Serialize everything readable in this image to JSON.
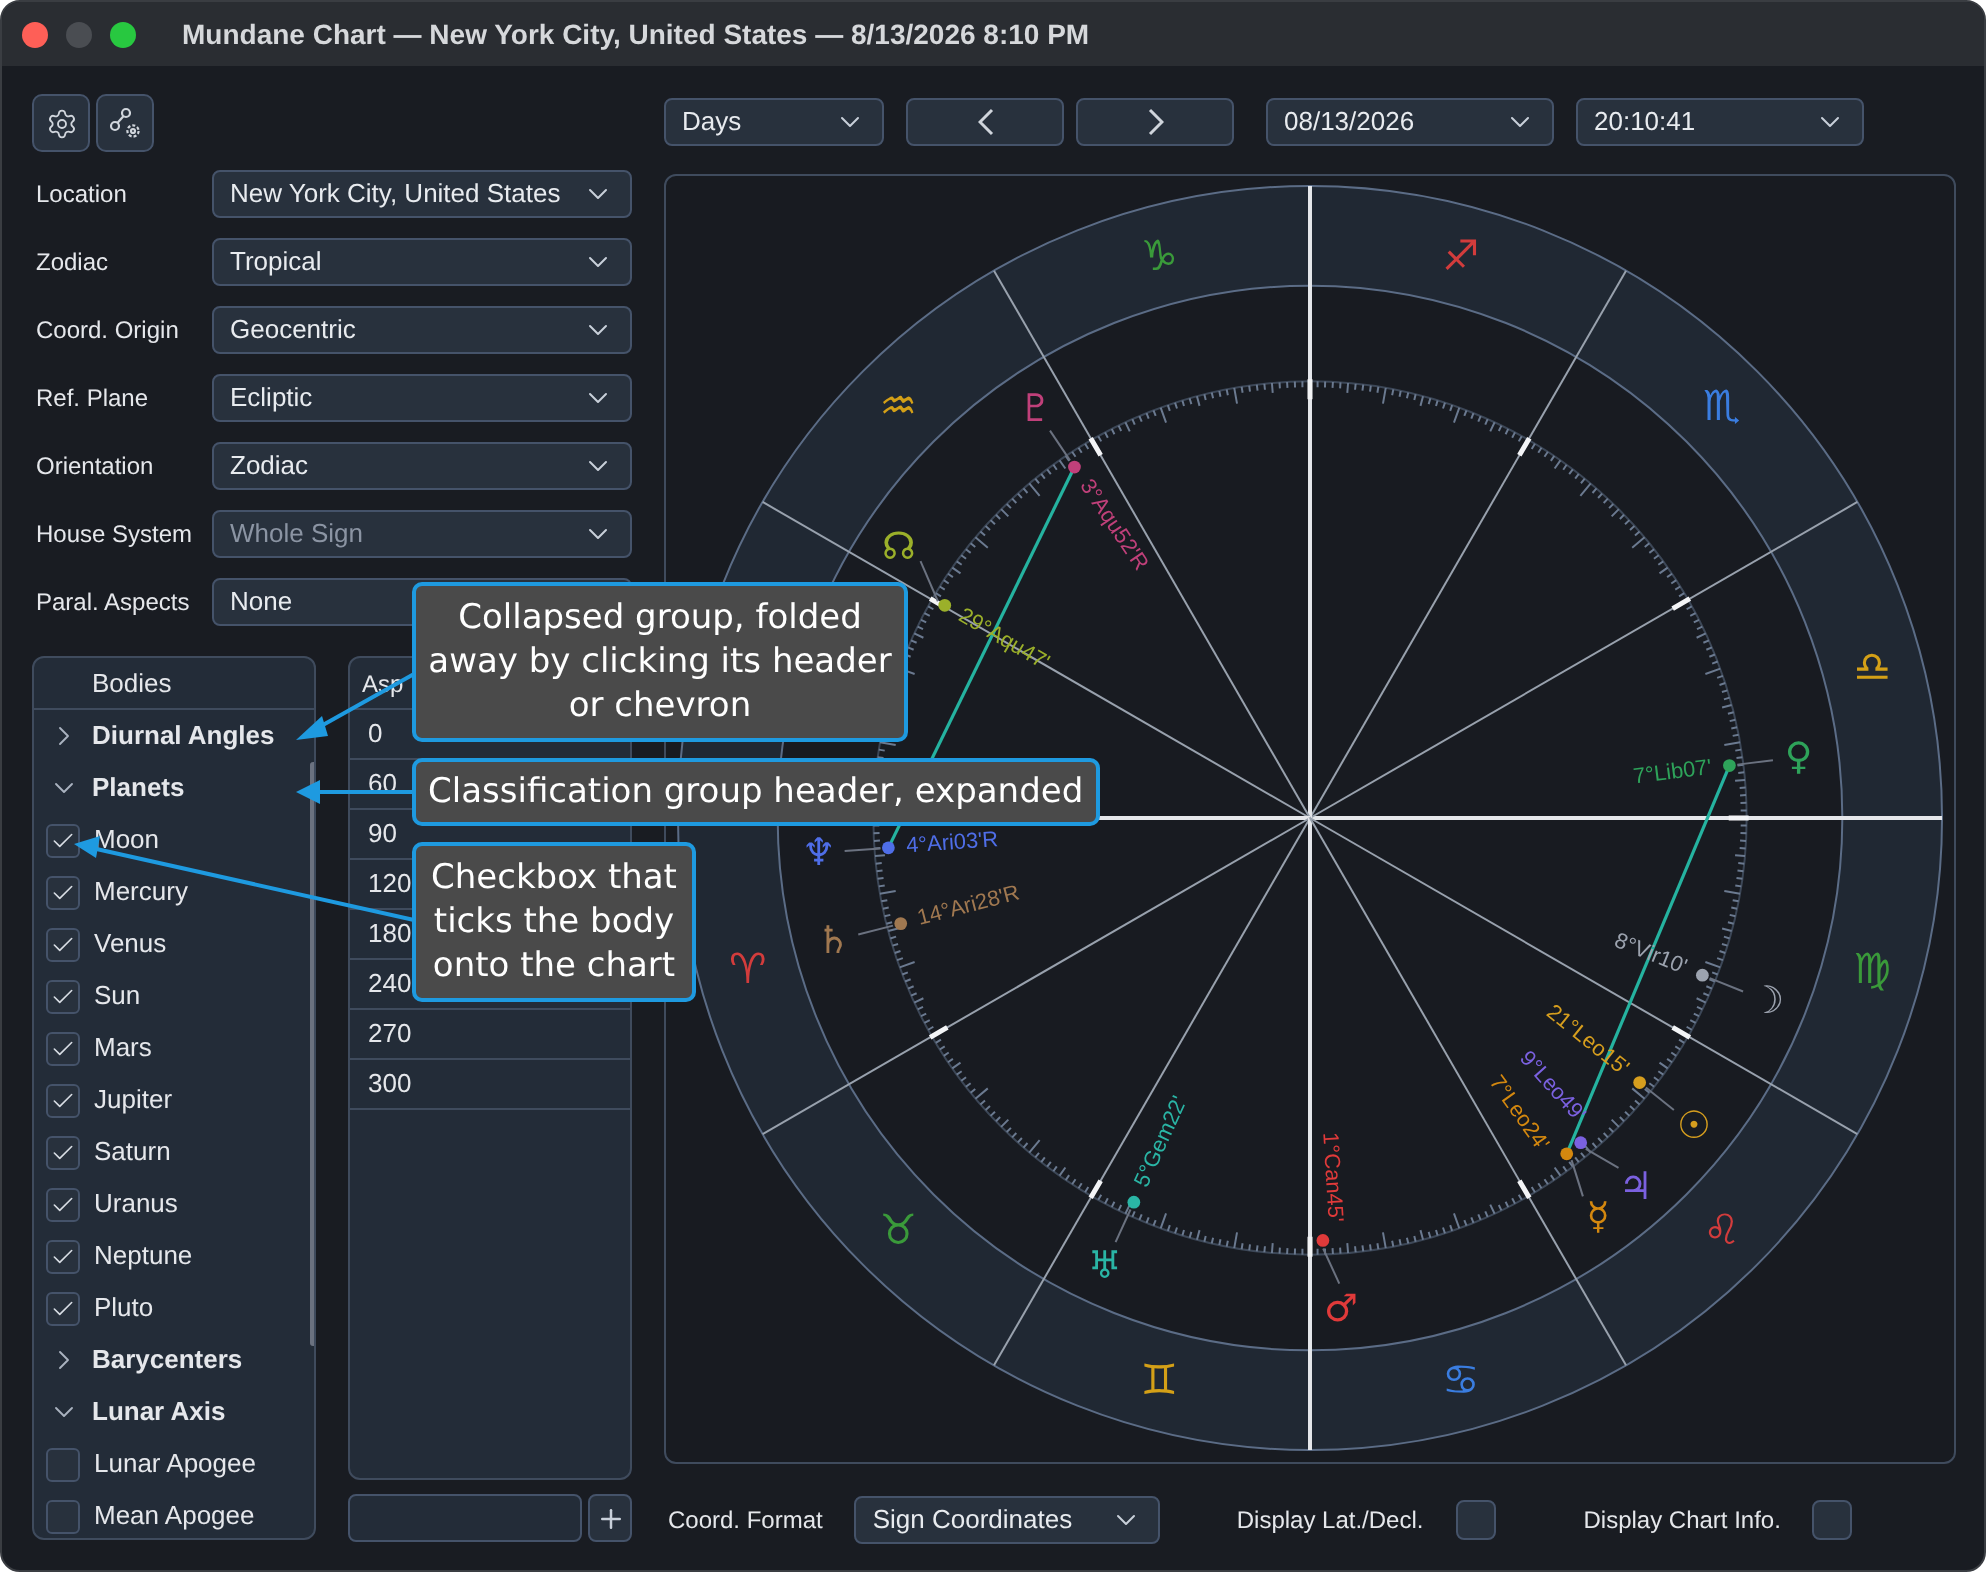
{
  "window": {
    "title": "Mundane Chart — New York City, United States — 8/13/2026 8:10 PM"
  },
  "settings": [
    {
      "label": "Location",
      "value": "New York City, United States",
      "disabled": false
    },
    {
      "label": "Zodiac",
      "value": "Tropical",
      "disabled": false
    },
    {
      "label": "Coord. Origin",
      "value": "Geocentric",
      "disabled": false
    },
    {
      "label": "Ref. Plane",
      "value": "Ecliptic",
      "disabled": false
    },
    {
      "label": "Orientation",
      "value": "Zodiac",
      "disabled": false
    },
    {
      "label": "House System",
      "value": "Whole Sign",
      "disabled": true
    },
    {
      "label": "Paral. Aspects",
      "value": "None",
      "disabled": false
    }
  ],
  "bodies_panel": {
    "header": "Bodies",
    "groups": [
      {
        "label": "Diurnal Angles",
        "expanded": false
      },
      {
        "label": "Planets",
        "expanded": true,
        "children": [
          {
            "label": "Moon",
            "checked": true
          },
          {
            "label": "Mercury",
            "checked": true
          },
          {
            "label": "Venus",
            "checked": true
          },
          {
            "label": "Sun",
            "checked": true
          },
          {
            "label": "Mars",
            "checked": true
          },
          {
            "label": "Jupiter",
            "checked": true
          },
          {
            "label": "Saturn",
            "checked": true
          },
          {
            "label": "Uranus",
            "checked": true
          },
          {
            "label": "Neptune",
            "checked": true
          },
          {
            "label": "Pluto",
            "checked": true
          }
        ]
      },
      {
        "label": "Barycenters",
        "expanded": false
      },
      {
        "label": "Lunar Axis",
        "expanded": true,
        "children": [
          {
            "label": "Lunar Apogee",
            "checked": false
          },
          {
            "label": "Mean Apogee",
            "checked": false
          }
        ]
      }
    ]
  },
  "aspects_panel": {
    "header": "Asp",
    "rows": [
      "0",
      "60",
      "90",
      "120",
      "180",
      "240",
      "270",
      "300"
    ]
  },
  "toolbar": {
    "step": "Days",
    "date": "08/13/2026",
    "time": "20:10:41"
  },
  "chart": {
    "signs": [
      {
        "glyph": "♈",
        "color": "#d23c3c"
      },
      {
        "glyph": "♉",
        "color": "#3a9a3a"
      },
      {
        "glyph": "♊",
        "color": "#d4a017"
      },
      {
        "glyph": "♋",
        "color": "#3a7de0"
      },
      {
        "glyph": "♌",
        "color": "#d23c3c"
      },
      {
        "glyph": "♍",
        "color": "#3a9a3a"
      },
      {
        "glyph": "♎",
        "color": "#d4a017"
      },
      {
        "glyph": "♏",
        "color": "#3a7de0"
      },
      {
        "glyph": "♐",
        "color": "#d23c3c"
      },
      {
        "glyph": "♑",
        "color": "#3a9a3a"
      },
      {
        "glyph": "♒",
        "color": "#d4a017"
      }
    ],
    "bodies": [
      {
        "glyph": "☽",
        "label": "8°Vir10'",
        "color": "#9ca3af"
      },
      {
        "glyph": "☿",
        "label": "7°Leo24'",
        "color": "#d4880f"
      },
      {
        "glyph": "♀",
        "label": "7°Lib07'",
        "color": "#2ea35a"
      },
      {
        "glyph": "☉",
        "label": "21°Leo15'",
        "color": "#d69e1e"
      },
      {
        "glyph": "♂",
        "label": "1°Can45'",
        "color": "#e03a3a"
      },
      {
        "glyph": "♃",
        "label": "9°Leo49'",
        "color": "#7b61e0"
      },
      {
        "glyph": "♄",
        "label": "14°Ari28'R",
        "color": "#a07850"
      },
      {
        "glyph": "♅",
        "label": "5°Gem22'",
        "color": "#2ab5a5"
      },
      {
        "glyph": "♆",
        "label": "4°Ari03'R",
        "color": "#4f6ee8"
      },
      {
        "glyph": "♇",
        "label": "3°Aqu52'R",
        "color": "#c0407a"
      },
      {
        "glyph": "☊",
        "label": "29°Aqu47'",
        "color": "#9bb02a"
      }
    ]
  },
  "footer": {
    "coord_format_label": "Coord. Format",
    "coord_format": "Sign Coordinates",
    "lat_decl_label": "Display Lat./Decl.",
    "lat_decl_checked": false,
    "chart_info_label": "Display Chart Info.",
    "chart_info_checked": false
  },
  "callouts": [
    {
      "text": "Collapsed group, folded away by clicking its header or chevron"
    },
    {
      "text": "Classification group header, expanded"
    },
    {
      "text": "Checkbox that ticks the body onto the chart"
    }
  ]
}
